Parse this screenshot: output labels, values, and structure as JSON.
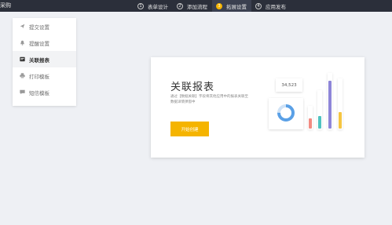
{
  "topbar": {
    "app_title": "采购",
    "steps": [
      {
        "num": "1",
        "label": "表单设计"
      },
      {
        "num": "2",
        "label": "添加流程"
      },
      {
        "num": "3",
        "label": "拓展设置"
      },
      {
        "num": "4",
        "label": "应用发布"
      }
    ],
    "active_step": 3
  },
  "sidebar": {
    "items": [
      {
        "label": "提交设置",
        "icon": "send-icon"
      },
      {
        "label": "提醒设置",
        "icon": "bell-icon"
      },
      {
        "label": "关联报表",
        "icon": "report-icon"
      },
      {
        "label": "打印模板",
        "icon": "printer-icon"
      },
      {
        "label": "短信模板",
        "icon": "message-icon"
      }
    ],
    "active_index": 2
  },
  "main": {
    "title": "关联报表",
    "description": "通过【数据关联】字段将其他应用中的报表关联至数据详情弹窗中",
    "start_button": "开始创建",
    "stat_value": "34,523",
    "bars": [
      {
        "color": "#f28b82",
        "level": 0.2
      },
      {
        "color": "#4fc3c0",
        "level": 0.25
      },
      {
        "color": "#8e86d8",
        "level": 0.95
      },
      {
        "color": "#f5c542",
        "level": 0.33
      }
    ],
    "pie": {
      "segments": [
        0.75,
        0.25
      ],
      "colors": [
        "#5aa0e6",
        "#cfe2f6"
      ]
    }
  },
  "colors": {
    "accent": "#f5b400",
    "topbar_bg": "#2b2f3a",
    "page_bg": "#eef0f4"
  }
}
